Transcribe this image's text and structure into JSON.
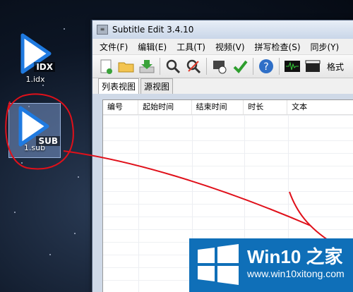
{
  "desktop": {
    "icons": [
      {
        "name": "1.idx",
        "tag": "IDX",
        "selected": false
      },
      {
        "name": "1.sub",
        "tag": "SUB",
        "selected": true
      }
    ]
  },
  "window": {
    "title": "Subtitle Edit 3.4.10",
    "menu": [
      "文件(F)",
      "编辑(E)",
      "工具(T)",
      "视频(V)",
      "拼写检查(S)",
      "同步(Y)"
    ],
    "toolbar_format_label": "格式",
    "tabs": [
      "列表视图",
      "源视图"
    ],
    "columns": [
      "编号",
      "起始时间",
      "结束时间",
      "时长",
      "文本"
    ]
  },
  "watermark": {
    "brand": "Win10 之家",
    "site": "www.win10xitong.com"
  },
  "colors": {
    "annotation_red": "#e0101a",
    "logo_blue": "#0f6fb8",
    "icon_blue": "#1f7ae0"
  }
}
